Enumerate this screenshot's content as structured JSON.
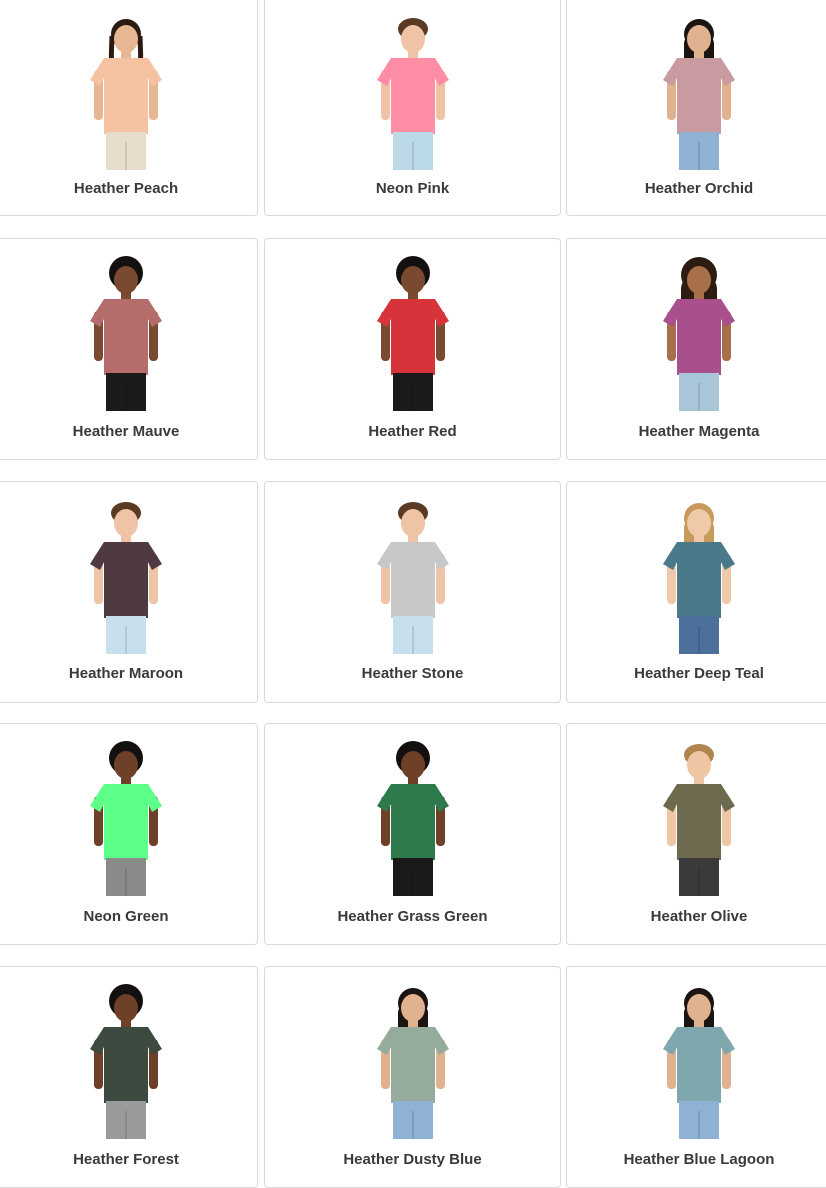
{
  "swatches": [
    {
      "label": "Heather Peach",
      "shirt": "#f6c3a2",
      "pants": "#e8dccd",
      "hair": "#2b1a12",
      "skin": "#e7b693",
      "hairstyle": "braids"
    },
    {
      "label": "Neon Pink",
      "shirt": "#ff8da6",
      "pants": "#bcd9e8",
      "hair": "#5a3a22",
      "skin": "#eec3a6",
      "hairstyle": "short"
    },
    {
      "label": "Heather Orchid",
      "shirt": "#c99a9f",
      "pants": "#8fb2d4",
      "hair": "#1c1410",
      "skin": "#e0b28f",
      "hairstyle": "long"
    },
    {
      "label": "Heather Mauve",
      "shirt": "#b56d6c",
      "pants": "#1a1a1a",
      "hair": "#151010",
      "skin": "#7a4a30",
      "hairstyle": "curly"
    },
    {
      "label": "Heather Red",
      "shirt": "#d6343a",
      "pants": "#1a1a1a",
      "hair": "#151010",
      "skin": "#7a4a30",
      "hairstyle": "curly"
    },
    {
      "label": "Heather Magenta",
      "shirt": "#a9508c",
      "pants": "#a9c6d8",
      "hair": "#2e1c12",
      "skin": "#a8704a",
      "hairstyle": "curlylong"
    },
    {
      "label": "Heather Maroon",
      "shirt": "#4e3a40",
      "pants": "#c8e0ee",
      "hair": "#5a3a22",
      "skin": "#eec3a6",
      "hairstyle": "short"
    },
    {
      "label": "Heather Stone",
      "shirt": "#c8c8c8",
      "pants": "#c8e0ee",
      "hair": "#5a3a22",
      "skin": "#eec3a6",
      "hairstyle": "short"
    },
    {
      "label": "Heather Deep Teal",
      "shirt": "#4a7a8a",
      "pants": "#4c6f9c",
      "hair": "#c79a5c",
      "skin": "#f0c9a8",
      "hairstyle": "long"
    },
    {
      "label": "Neon Green",
      "shirt": "#5cff87",
      "pants": "#8a8a8a",
      "hair": "#151010",
      "skin": "#6e4028",
      "hairstyle": "curly"
    },
    {
      "label": "Heather Grass Green",
      "shirt": "#2f7a4c",
      "pants": "#1a1a1a",
      "hair": "#151010",
      "skin": "#6e4028",
      "hairstyle": "curly"
    },
    {
      "label": "Heather Olive",
      "shirt": "#6e6a50",
      "pants": "#3a3a3a",
      "hair": "#b0844c",
      "skin": "#efc6a4",
      "hairstyle": "short"
    },
    {
      "label": "Heather Forest",
      "shirt": "#3d4a40",
      "pants": "#9a9a9a",
      "hair": "#151010",
      "skin": "#6e4028",
      "hairstyle": "curly"
    },
    {
      "label": "Heather Dusty Blue",
      "shirt": "#95ab9c",
      "pants": "#8fb2d4",
      "hair": "#1c1410",
      "skin": "#e0b28f",
      "hairstyle": "long"
    },
    {
      "label": "Heather Blue Lagoon",
      "shirt": "#7ea8ad",
      "pants": "#8fb2d4",
      "hair": "#1c1410",
      "skin": "#e0b28f",
      "hairstyle": "long"
    }
  ]
}
